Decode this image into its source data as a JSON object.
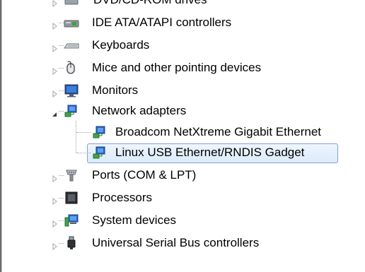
{
  "tree": {
    "partial_top_label": "DVD/CD-ROM drives",
    "items": [
      {
        "label": "IDE ATA/ATAPI controllers",
        "icon": "ide-controller-icon"
      },
      {
        "label": "Keyboards",
        "icon": "keyboard-icon"
      },
      {
        "label": "Mice and other pointing devices",
        "icon": "mouse-icon"
      },
      {
        "label": "Monitors",
        "icon": "monitor-icon"
      },
      {
        "label": "Network adapters",
        "icon": "network-adapter-icon",
        "expanded": true
      },
      {
        "label": "Broadcom NetXtreme Gigabit Ethernet",
        "icon": "network-adapter-icon",
        "child": true
      },
      {
        "label": "Linux USB Ethernet/RNDIS Gadget",
        "icon": "network-adapter-icon",
        "child": true,
        "selected": true
      },
      {
        "label": "Ports (COM & LPT)",
        "icon": "port-icon"
      },
      {
        "label": "Processors",
        "icon": "processor-icon"
      },
      {
        "label": "System devices",
        "icon": "system-devices-icon"
      },
      {
        "label": "Universal Serial Bus controllers",
        "icon": "usb-icon"
      }
    ]
  },
  "colors": {
    "selection_border": "#7da2ce",
    "selection_fill": "#dcebfc",
    "tree_lines": "#a0a0a0"
  }
}
